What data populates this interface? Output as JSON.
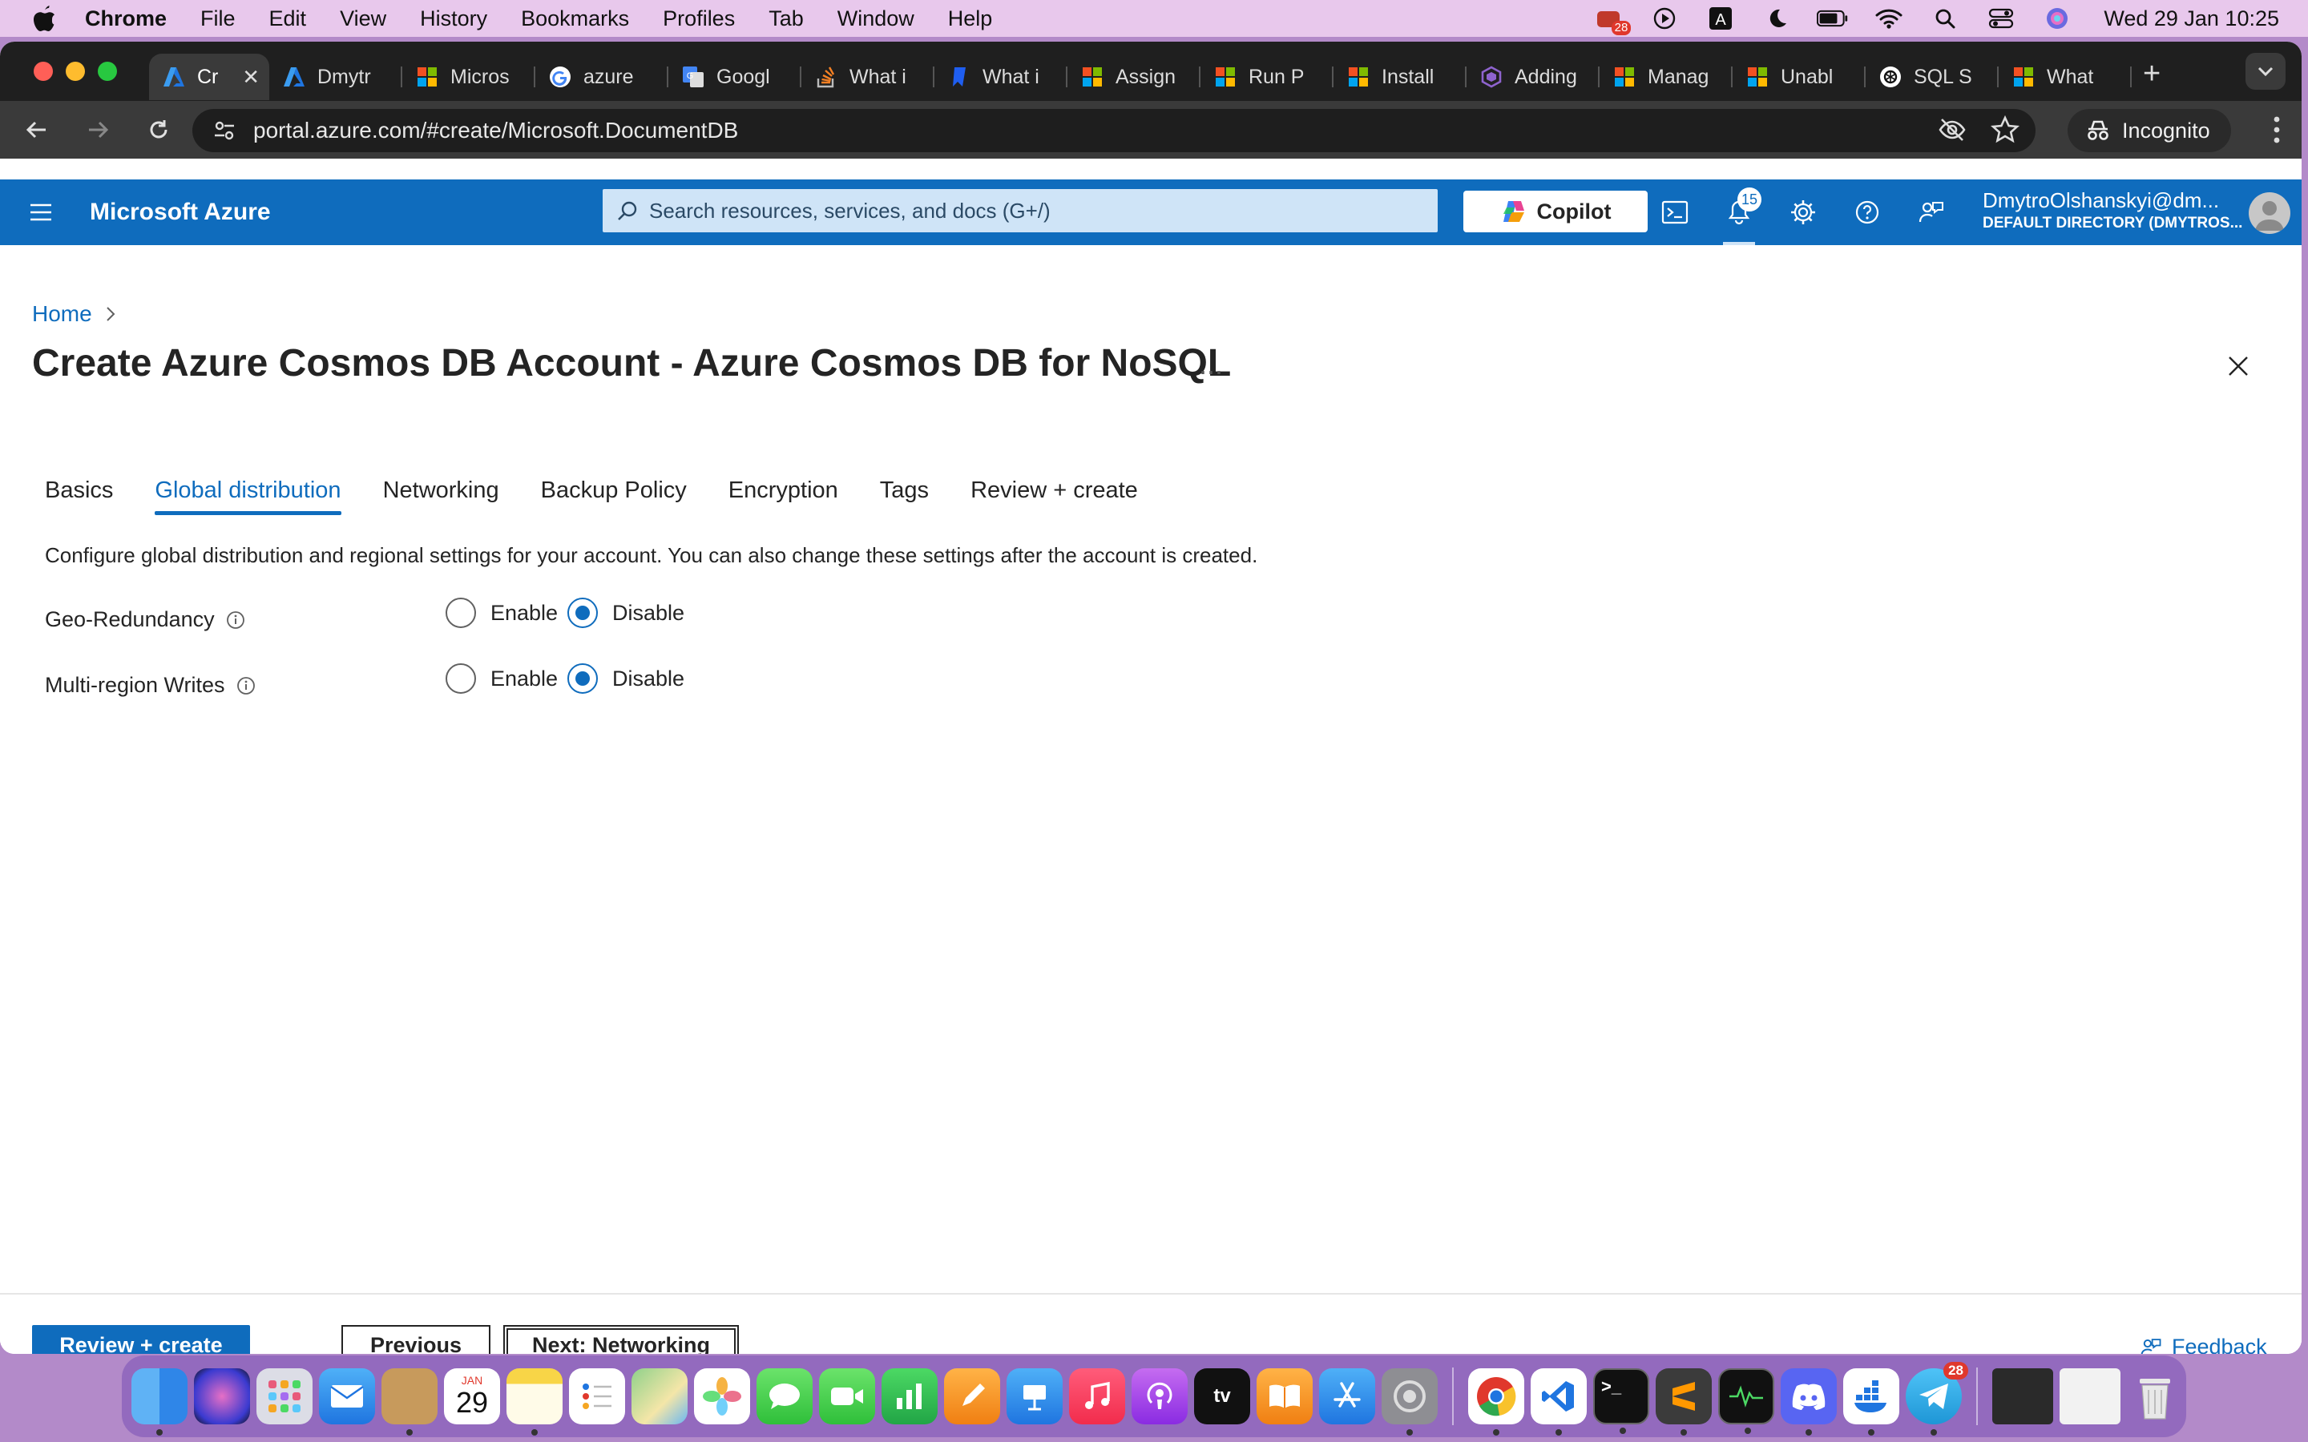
{
  "menubar": {
    "app": "Chrome",
    "items": [
      "File",
      "Edit",
      "View",
      "History",
      "Bookmarks",
      "Profiles",
      "Tab",
      "Window",
      "Help"
    ],
    "clock": "Wed 29 Jan  10:25",
    "badge": "28"
  },
  "browser": {
    "tabs": [
      {
        "title": "Cr",
        "icon": "azure-icon",
        "active": true
      },
      {
        "title": "Dmytr",
        "icon": "azure-icon"
      },
      {
        "title": "Micros",
        "icon": "microsoft-icon"
      },
      {
        "title": "azure",
        "icon": "google-icon"
      },
      {
        "title": "Googl",
        "icon": "google-translate-icon"
      },
      {
        "title": "What i",
        "icon": "stackoverflow-icon"
      },
      {
        "title": "What i",
        "icon": "bookmark-icon"
      },
      {
        "title": "Assign",
        "icon": "microsoft-icon"
      },
      {
        "title": "Run P",
        "icon": "microsoft-icon"
      },
      {
        "title": "Install",
        "icon": "microsoft-icon"
      },
      {
        "title": "Adding",
        "icon": "hex-icon"
      },
      {
        "title": "Manag",
        "icon": "microsoft-icon"
      },
      {
        "title": "Unabl",
        "icon": "microsoft-icon"
      },
      {
        "title": "SQL S",
        "icon": "openai-icon"
      },
      {
        "title": "What",
        "icon": "microsoft-icon"
      }
    ],
    "url": "portal.azure.com/#create/Microsoft.DocumentDB",
    "incognito": "Incognito"
  },
  "azure": {
    "brand": "Microsoft Azure",
    "search_placeholder": "Search resources, services, and docs (G+/)",
    "copilot": "Copilot",
    "notifications": "15",
    "user_name": "DmytroOlshanskyi@dm...",
    "user_directory": "DEFAULT DIRECTORY (DMYTROS..."
  },
  "page": {
    "breadcrumb": "Home",
    "title": "Create Azure Cosmos DB Account - Azure Cosmos DB for NoSQL",
    "ellipsis": "...",
    "tabs": [
      "Basics",
      "Global distribution",
      "Networking",
      "Backup Policy",
      "Encryption",
      "Tags",
      "Review + create"
    ],
    "selected_tab": "Global distribution",
    "description": "Configure global distribution and regional settings for your account. You can also change these settings after the account is created.",
    "fields": [
      {
        "label": "Geo-Redundancy",
        "options": [
          "Enable",
          "Disable"
        ],
        "selected": "Disable"
      },
      {
        "label": "Multi-region Writes",
        "options": [
          "Enable",
          "Disable"
        ],
        "selected": "Disable"
      }
    ]
  },
  "footer": {
    "review_create": "Review + create",
    "previous": "Previous",
    "next": "Next: Networking",
    "feedback": "Feedback"
  },
  "dock": {
    "calendar_month": "JAN",
    "calendar_day": "29",
    "telegram_badge": "28"
  },
  "colors": {
    "azure_blue": "#0f6cbd",
    "menubar": "#e8c8ec",
    "desktop": "#b38ac9"
  }
}
